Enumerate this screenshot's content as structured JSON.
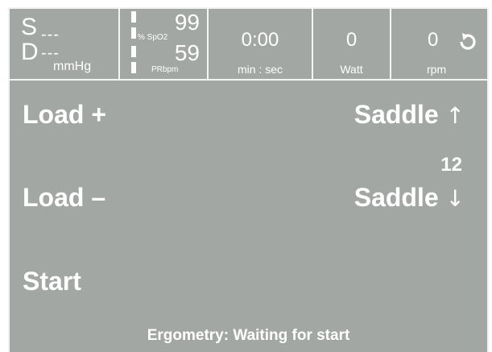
{
  "status_bar": {
    "blood_pressure": {
      "systolic_label": "S",
      "systolic_value": "---",
      "diastolic_label": "D",
      "diastolic_value": "---",
      "unit": "mmHg"
    },
    "pulse_oximeter": {
      "spo2_value": "99",
      "spo2_label": "% SpO2",
      "pr_value": "59",
      "pr_label": "PRbpm"
    },
    "timer": {
      "value": "0:00",
      "unit": "min : sec"
    },
    "power": {
      "value": "0",
      "unit": "Watt"
    },
    "cadence": {
      "value": "0",
      "unit": "rpm",
      "icon": "rotate-icon"
    }
  },
  "controls": {
    "load_plus": "Load +",
    "load_minus": "Load –",
    "start": "Start",
    "saddle_up": "Saddle",
    "saddle_up_arrow": "↑",
    "saddle_down": "Saddle",
    "saddle_down_arrow": "↓",
    "saddle_position": "12"
  },
  "status_message": "Ergometry: Waiting for start",
  "colors": {
    "screen_background": "#a3a7a4",
    "text": "#ffffff",
    "divider": "#f4f4f4"
  }
}
